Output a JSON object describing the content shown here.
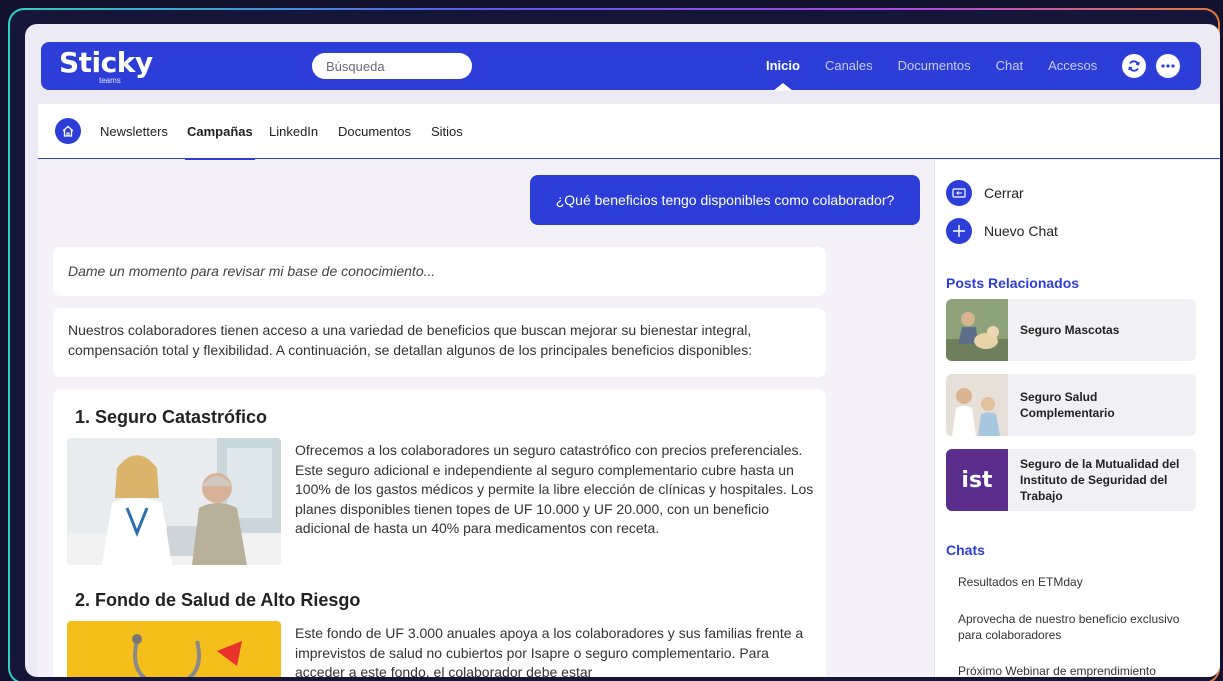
{
  "app": {
    "logo": "Sticky",
    "logo_sub": "teams",
    "search_placeholder": "Búsqueda",
    "nav": [
      {
        "label": "Inicio",
        "active": true
      },
      {
        "label": "Canales"
      },
      {
        "label": "Documentos"
      },
      {
        "label": "Chat"
      },
      {
        "label": "Accesos"
      }
    ],
    "refresh_icon": "refresh-icon",
    "more_icon": "more-icon",
    "accent": "#2d3ed8"
  },
  "tabs": [
    {
      "label": "Newsletters"
    },
    {
      "label": "Campañas",
      "active": true
    },
    {
      "label": "LinkedIn"
    },
    {
      "label": "Documentos"
    },
    {
      "label": "Sitios"
    }
  ],
  "chat": {
    "user_message": "¿Qué beneficios tengo disponibles como colaborador?",
    "thinking": "Dame un momento para revisar mi base de conocimiento...",
    "intro": "Nuestros colaboradores tienen acceso a una variedad de beneficios que buscan mejorar su bienestar integral, compensación total y flexibilidad. A continuación, se detallan algunos de los principales beneficios disponibles:",
    "benefits": [
      {
        "title": "1. Seguro Catastrófico",
        "text": "Ofrecemos a los colaboradores un seguro catastrófico con precios preferenciales. Este seguro adicional e independiente al seguro complementario cubre hasta un 100% de los gastos médicos y permite la libre elección de clínicas y hospitales. Los planes disponibles tienen topes de UF 10.000 y UF 20.000, con un beneficio adicional de hasta un 40% para medicamentos con receta."
      },
      {
        "title": "2. Fondo de Salud de Alto Riesgo",
        "text": "Este fondo de UF 3.000 anuales apoya a los colaboradores y sus familias frente a imprevistos de salud no cubiertos por Isapre o seguro complementario. Para acceder a este fondo, el colaborador debe estar"
      }
    ]
  },
  "sidebar": {
    "close_label": "Cerrar",
    "new_chat_label": "Nuevo Chat",
    "posts_heading": "Posts Relacionados",
    "posts": [
      {
        "title": "Seguro Mascotas"
      },
      {
        "title": "Seguro Salud Complementario"
      },
      {
        "title": "Seguro de la Mutualidad del Instituto de Seguridad del Trabajo",
        "thumb_text": "ist"
      }
    ],
    "chats_heading": "Chats",
    "chats": [
      {
        "title": "Resultados en ETMday"
      },
      {
        "title": "Aprovecha de nuestro beneficio exclusivo para colaboradores"
      },
      {
        "title": "Próximo Webinar de emprendimiento"
      }
    ]
  }
}
